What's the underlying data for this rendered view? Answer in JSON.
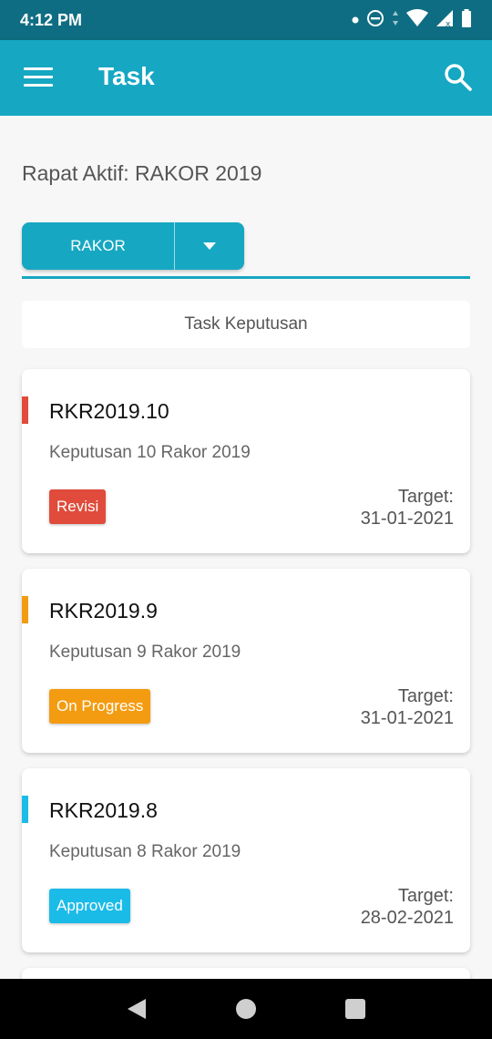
{
  "status_bar": {
    "time": "4:12 PM",
    "icons": [
      "notification-dot-icon",
      "do-not-disturb-icon",
      "data-arrows-icon",
      "wifi-icon",
      "signal-icon",
      "battery-icon"
    ]
  },
  "app_bar": {
    "title": "Task",
    "menu_icon": "hamburger-menu-icon",
    "search_icon": "search-icon"
  },
  "active_meeting": "Rapat Aktif: RAKOR 2019",
  "meeting_dropdown": {
    "selected": "RAKOR"
  },
  "section_header": "Task Keputusan",
  "tasks": [
    {
      "code": "RKR2019.10",
      "description": "Keputusan 10 Rakor 2019",
      "status": "Revisi",
      "status_color": "#e04b3b",
      "target_label": "Target:",
      "target_date": "31-01-2021"
    },
    {
      "code": "RKR2019.9",
      "description": "Keputusan 9 Rakor 2019",
      "status": "On Progress",
      "status_color": "#f39c12",
      "target_label": "Target:",
      "target_date": "31-01-2021"
    },
    {
      "code": "RKR2019.8",
      "description": "Keputusan 8 Rakor 2019",
      "status": "Approved",
      "status_color": "#1bbbe8",
      "target_label": "Target:",
      "target_date": "28-02-2021"
    }
  ],
  "colors": {
    "primary": "#16a7c2",
    "status_bar": "#0f6d83"
  },
  "nav_bar": {
    "icons": [
      "back-icon",
      "home-icon",
      "recents-icon"
    ]
  }
}
